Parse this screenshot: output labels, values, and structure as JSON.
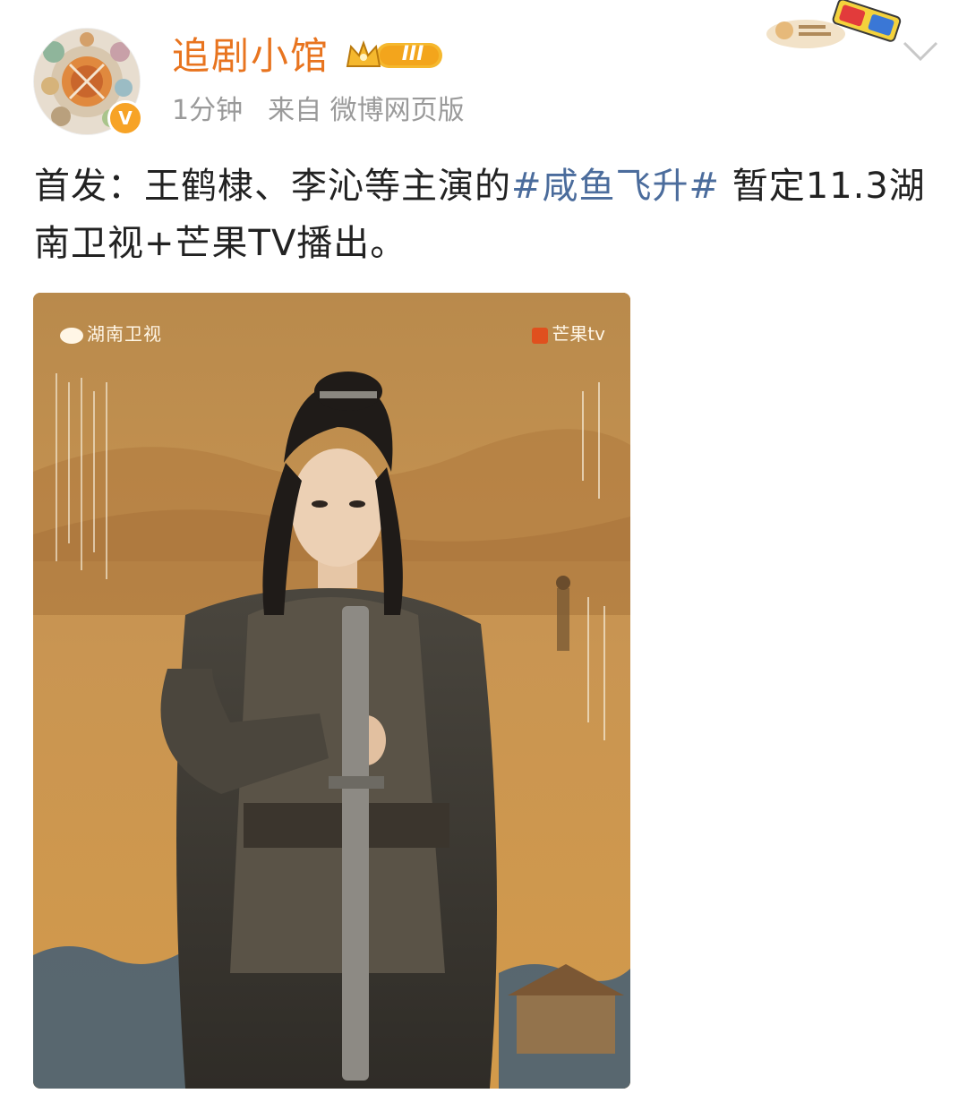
{
  "header": {
    "username": "追剧小馆",
    "level_label": "III",
    "time": "1分钟",
    "source": "来自 微博网页版"
  },
  "post": {
    "text_prefix": "首发：王鹤棣、李沁等主演的",
    "hashtag": "#咸鱼飞升#",
    "text_suffix": " 暂定11.3湖南卫视+芒果TV播出。"
  },
  "poster": {
    "logo_left": "湖南卫视",
    "logo_right": "芒果tv"
  },
  "icons": {
    "verify": "verified-v-icon",
    "level": "crown-level-icon",
    "more": "chevron-down-icon",
    "sticker": "3d-glasses-sticker-icon"
  },
  "colors": {
    "username": "#e8741f",
    "hashtag": "#4b6c9c",
    "meta": "#9a9a9a",
    "verify_badge": "#f7a326"
  }
}
